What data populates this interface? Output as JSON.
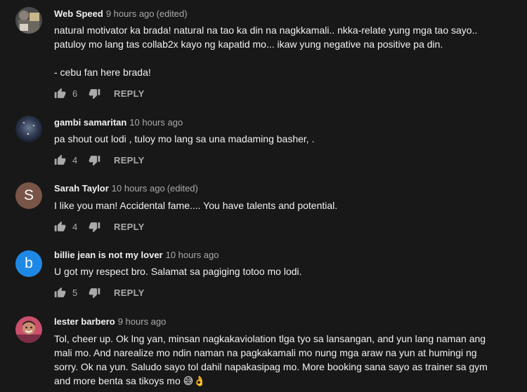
{
  "ui": {
    "reply_label": "REPLY",
    "edited_label": "(edited)"
  },
  "comments": [
    {
      "author": "Web Speed",
      "time": "9 hours ago",
      "edited": true,
      "avatar_icon": "photo-avatar",
      "lines": [
        "natural motivator ka brada! natural na tao ka din na nagkkamali.. nkka-relate yung mga tao sayo..",
        "patuloy mo lang tas collab2x kayo ng kapatid mo... ikaw yung negative na positive pa din.",
        "",
        "- cebu fan here brada!"
      ],
      "likes": "6"
    },
    {
      "author": "gambi samaritan",
      "time": "10 hours ago",
      "edited": false,
      "avatar_icon": "photo-avatar",
      "lines": [
        "pa shout out lodi , tuloy mo lang sa una madaming basher, ."
      ],
      "likes": "4"
    },
    {
      "author": "Sarah Taylor",
      "time": "10 hours ago",
      "edited": true,
      "avatar_letter": "S",
      "avatar_color": "#795548",
      "lines": [
        "I like you man! Accidental fame.... You have talents and potential."
      ],
      "likes": "4"
    },
    {
      "author": "billie jean is not my lover",
      "time": "10 hours ago",
      "edited": false,
      "avatar_letter": "b",
      "avatar_color": "#1e88e5",
      "lines": [
        "U got my respect bro. Salamat sa pagiging totoo mo lodi."
      ],
      "likes": "5"
    },
    {
      "author": "lester barbero",
      "time": "9 hours ago",
      "edited": false,
      "avatar_icon": "photo-avatar",
      "lines": [
        "Tol, cheer up. Ok lng yan, minsan nagkakaviolation tlga tyo sa lansangan, and yun lang naman ang",
        "mali mo. And narealize mo ndin naman na pagkakamali mo nung mga araw na yun at humingi ng",
        "sorry. Ok na yun. Saludo sayo tol dahil napakasipag mo. More booking sana sayo as trainer sa gym",
        "and more benta sa tikoys mo 😅👌"
      ]
    }
  ]
}
